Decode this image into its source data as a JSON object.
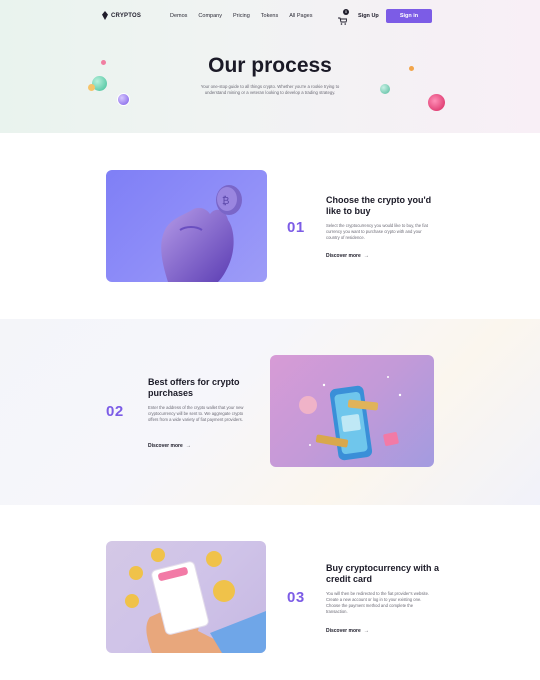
{
  "brand": {
    "name": "CRYPTOS"
  },
  "nav": {
    "links": [
      "Demos",
      "Company",
      "Pricing",
      "Tokens",
      "All Pages"
    ],
    "cart_count": "0",
    "signup_label": "Sign Up",
    "signin_label": "Sign in"
  },
  "hero": {
    "title": "Our process",
    "subtitle": "Your one-stop guide to all things crypto. Whether you're a rookie trying to understand mining or a veteran looking to develop a trading strategy."
  },
  "steps": [
    {
      "number": "01",
      "title": "Choose the crypto you'd like to buy",
      "description": "Select the cryptocurrency you would like to buy, the fiat currency you want to purchase crypto with and your country of residence.",
      "link": "Discover more"
    },
    {
      "number": "02",
      "title": "Best offers for crypto purchases",
      "description": "Enter the address of the crypto wallet that your new cryptocurrency will be sent to. We aggregate crypto offers from a wide variety of fiat payment providers.",
      "link": "Discover more"
    },
    {
      "number": "03",
      "title": "Buy cryptocurrency with a credit card",
      "description": "You will then be redirected to the fiat provider's website. Create a new account or log in to your existing one. Choose the payment method and complete the transaction.",
      "link": "Discover more"
    }
  ],
  "colors": {
    "accent": "#7c5ce6",
    "text": "#1b1a27",
    "muted": "#6b6a75"
  }
}
